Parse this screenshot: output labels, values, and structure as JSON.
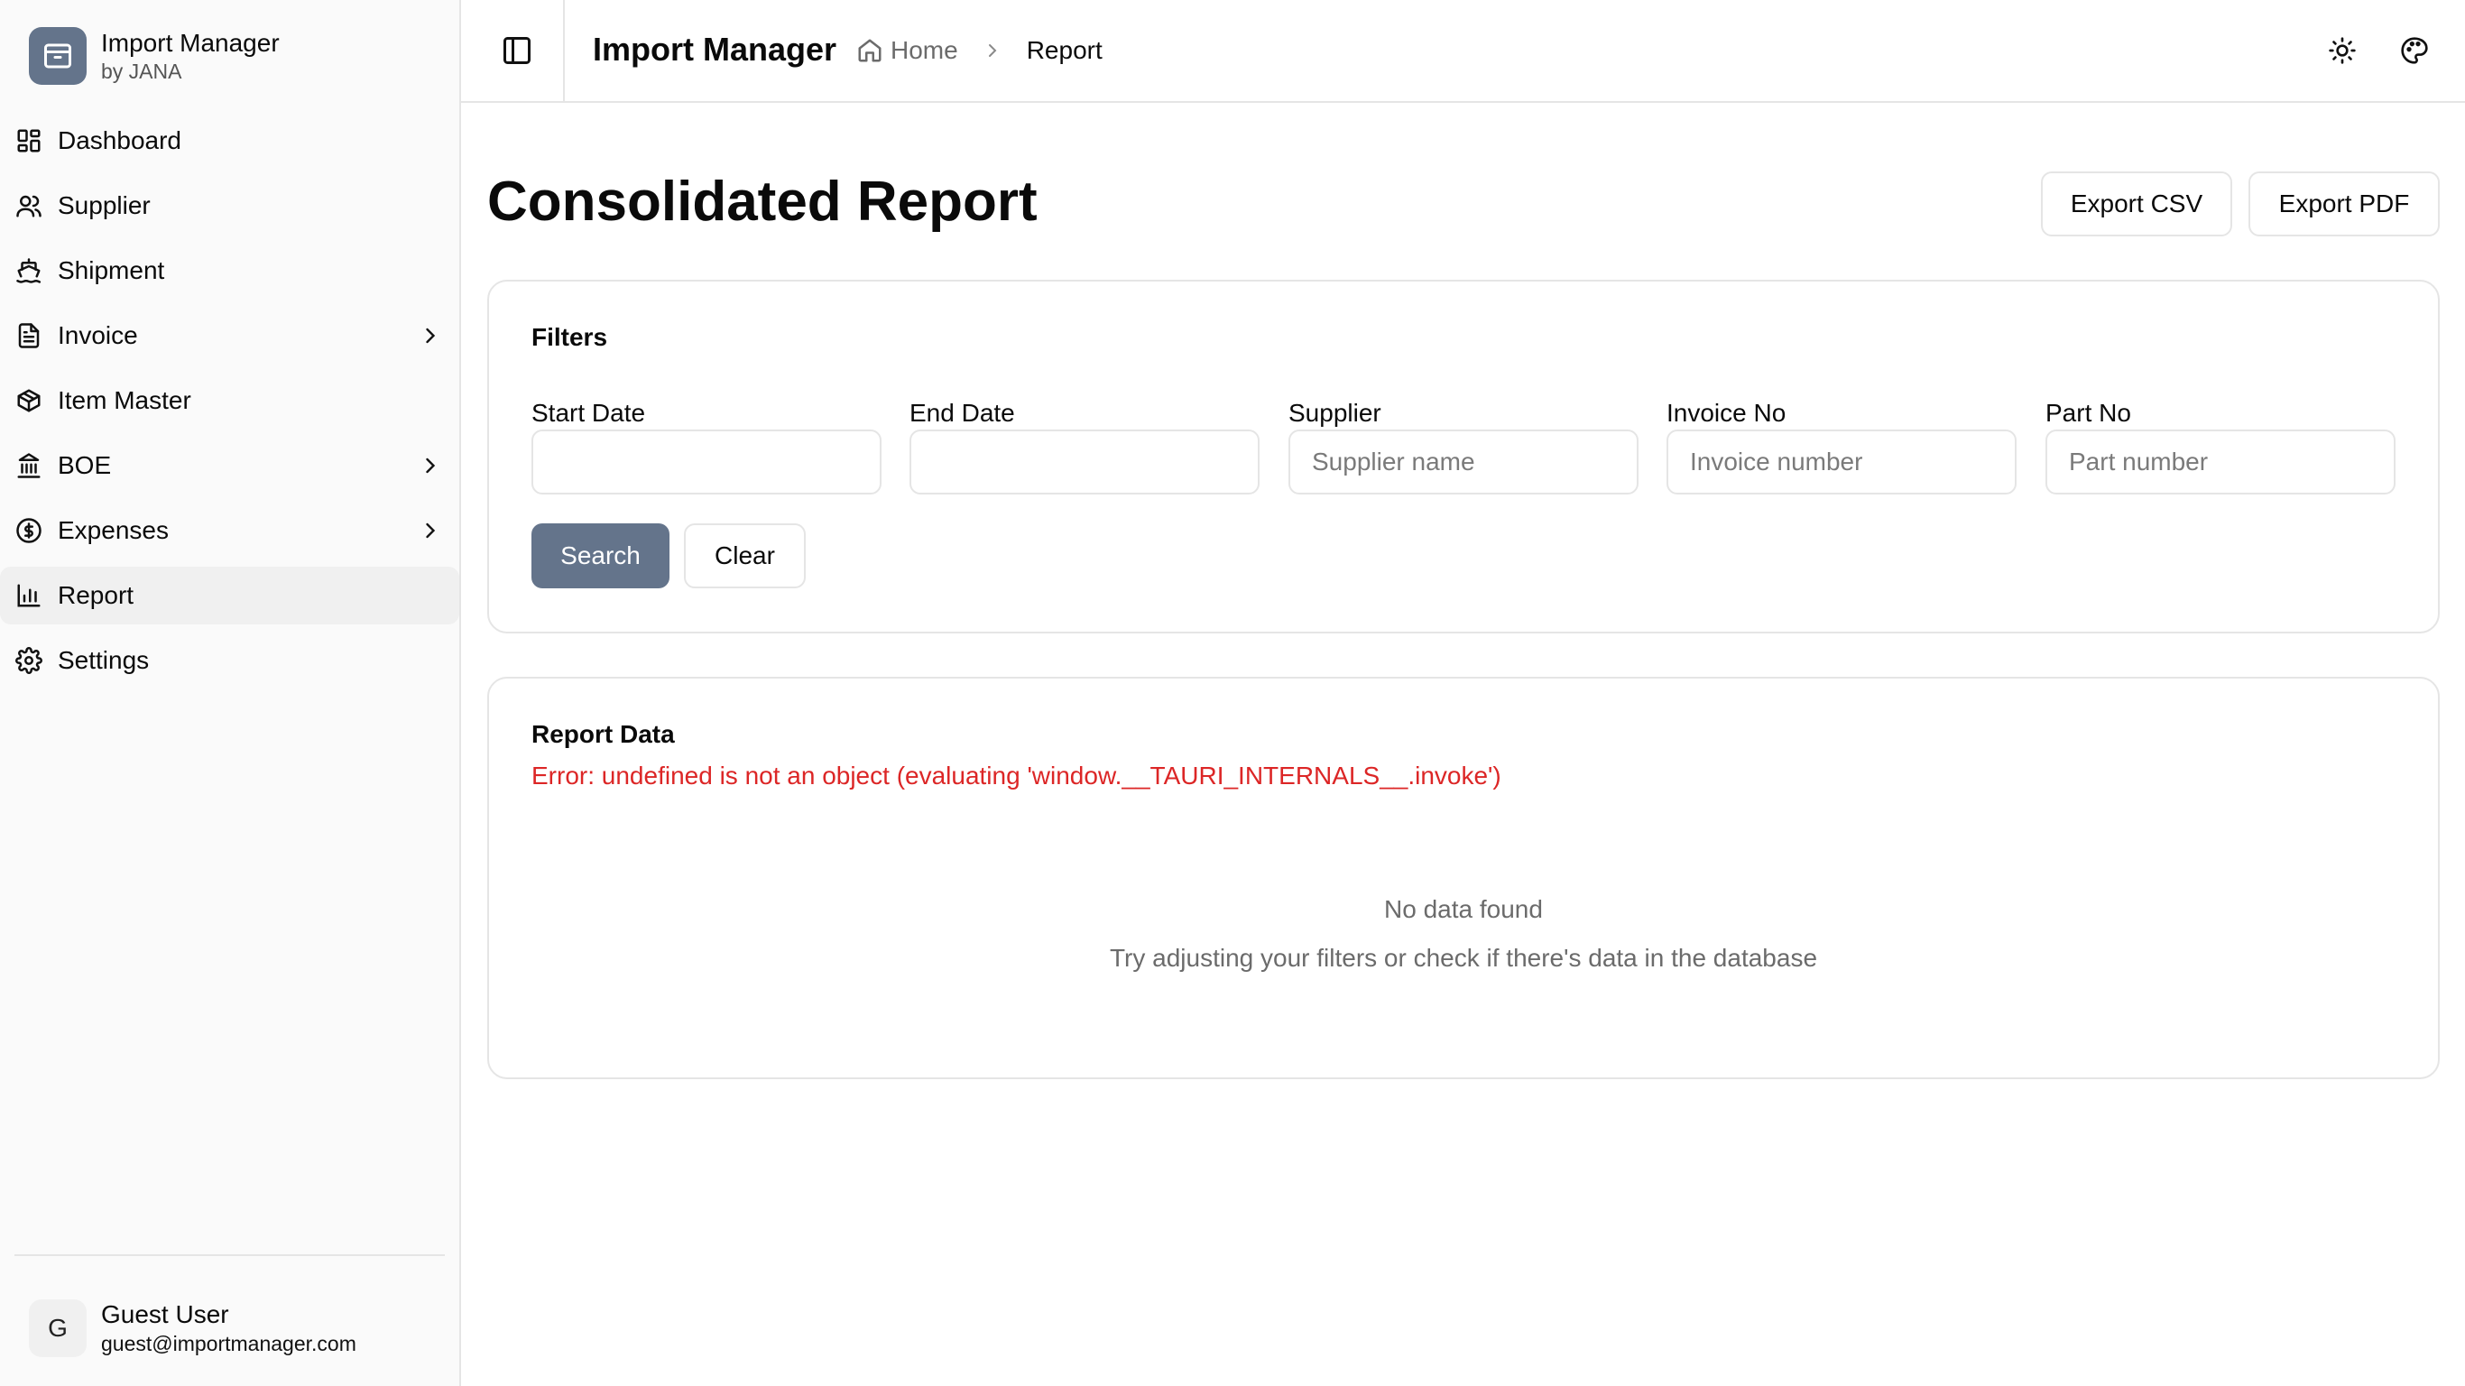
{
  "app": {
    "name": "Import Manager",
    "by": "by JANA"
  },
  "sidebar": {
    "items": [
      {
        "label": "Dashboard",
        "icon": "dashboard-icon",
        "has_children": false
      },
      {
        "label": "Supplier",
        "icon": "users-icon",
        "has_children": false
      },
      {
        "label": "Shipment",
        "icon": "ship-icon",
        "has_children": false
      },
      {
        "label": "Invoice",
        "icon": "file-text-icon",
        "has_children": true
      },
      {
        "label": "Item Master",
        "icon": "package-icon",
        "has_children": false
      },
      {
        "label": "BOE",
        "icon": "landmark-icon",
        "has_children": true
      },
      {
        "label": "Expenses",
        "icon": "dollar-circle-icon",
        "has_children": true
      },
      {
        "label": "Report",
        "icon": "bar-chart-icon",
        "has_children": false,
        "active": true
      },
      {
        "label": "Settings",
        "icon": "gear-icon",
        "has_children": false
      }
    ]
  },
  "user": {
    "initial": "G",
    "name": "Guest User",
    "email": "guest@importmanager.com"
  },
  "header": {
    "title": "Import Manager",
    "breadcrumb": {
      "home": "Home",
      "current": "Report"
    }
  },
  "main": {
    "title": "Consolidated Report",
    "export_csv": "Export CSV",
    "export_pdf": "Export PDF",
    "filters": {
      "title": "Filters",
      "start_date": {
        "label": "Start Date",
        "value": "",
        "placeholder": ""
      },
      "end_date": {
        "label": "End Date",
        "value": "",
        "placeholder": ""
      },
      "supplier": {
        "label": "Supplier",
        "value": "",
        "placeholder": "Supplier name"
      },
      "invoice_no": {
        "label": "Invoice No",
        "value": "",
        "placeholder": "Invoice number"
      },
      "part_no": {
        "label": "Part No",
        "value": "",
        "placeholder": "Part number"
      },
      "search_label": "Search",
      "clear_label": "Clear"
    },
    "report": {
      "title": "Report Data",
      "error": "Error: undefined is not an object (evaluating 'window.__TAURI_INTERNALS__.invoke')",
      "empty_title": "No data found",
      "empty_sub": "Try adjusting your filters or check if there's data in the database"
    }
  },
  "colors": {
    "accent": "#64748b",
    "error": "#dc2626",
    "muted": "#6b6b6b",
    "border": "#e5e5e5"
  }
}
